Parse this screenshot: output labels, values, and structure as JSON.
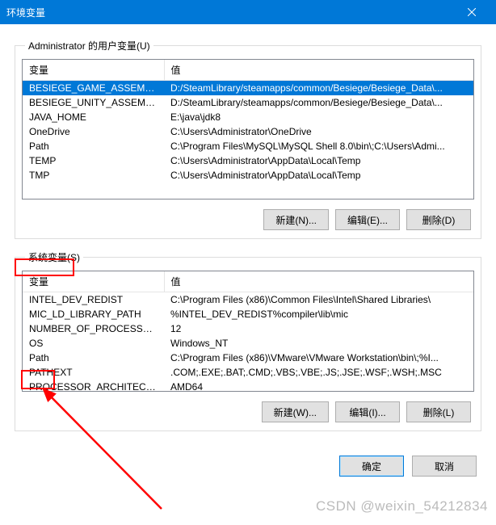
{
  "window": {
    "title": "环境变量",
    "close": "×"
  },
  "userSection": {
    "legend": "Administrator 的用户变量(U)",
    "headers": {
      "name": "变量",
      "value": "值"
    },
    "rows": [
      {
        "name": "BESIEGE_GAME_ASSEMBL...",
        "value": "D:/SteamLibrary/steamapps/common/Besiege/Besiege_Data\\...",
        "selected": true
      },
      {
        "name": "BESIEGE_UNITY_ASSEMBL...",
        "value": "D:/SteamLibrary/steamapps/common/Besiege/Besiege_Data\\..."
      },
      {
        "name": "JAVA_HOME",
        "value": "E:\\java\\jdk8"
      },
      {
        "name": "OneDrive",
        "value": "C:\\Users\\Administrator\\OneDrive"
      },
      {
        "name": "Path",
        "value": "C:\\Program Files\\MySQL\\MySQL Shell 8.0\\bin\\;C:\\Users\\Admi..."
      },
      {
        "name": "TEMP",
        "value": "C:\\Users\\Administrator\\AppData\\Local\\Temp"
      },
      {
        "name": "TMP",
        "value": "C:\\Users\\Administrator\\AppData\\Local\\Temp"
      }
    ],
    "buttons": {
      "new": "新建(N)...",
      "edit": "编辑(E)...",
      "del": "删除(D)"
    }
  },
  "sysSection": {
    "legend": "系统变量(S)",
    "headers": {
      "name": "变量",
      "value": "值"
    },
    "rows": [
      {
        "name": "INTEL_DEV_REDIST",
        "value": "C:\\Program Files (x86)\\Common Files\\Intel\\Shared Libraries\\"
      },
      {
        "name": "MIC_LD_LIBRARY_PATH",
        "value": "%INTEL_DEV_REDIST%compiler\\lib\\mic"
      },
      {
        "name": "NUMBER_OF_PROCESSORS",
        "value": "12"
      },
      {
        "name": "OS",
        "value": "Windows_NT"
      },
      {
        "name": "Path",
        "value": "C:\\Program Files (x86)\\VMware\\VMware Workstation\\bin\\;%I..."
      },
      {
        "name": "PATHEXT",
        "value": ".COM;.EXE;.BAT;.CMD;.VBS;.VBE;.JS;.JSE;.WSF;.WSH;.MSC"
      },
      {
        "name": "PROCESSOR_ARCHITECT...",
        "value": "AMD64"
      }
    ],
    "buttons": {
      "new": "新建(W)...",
      "edit": "编辑(I)...",
      "del": "删除(L)"
    }
  },
  "dialog": {
    "ok": "确定",
    "cancel": "取消"
  },
  "watermark": "CSDN @weixin_54212834"
}
